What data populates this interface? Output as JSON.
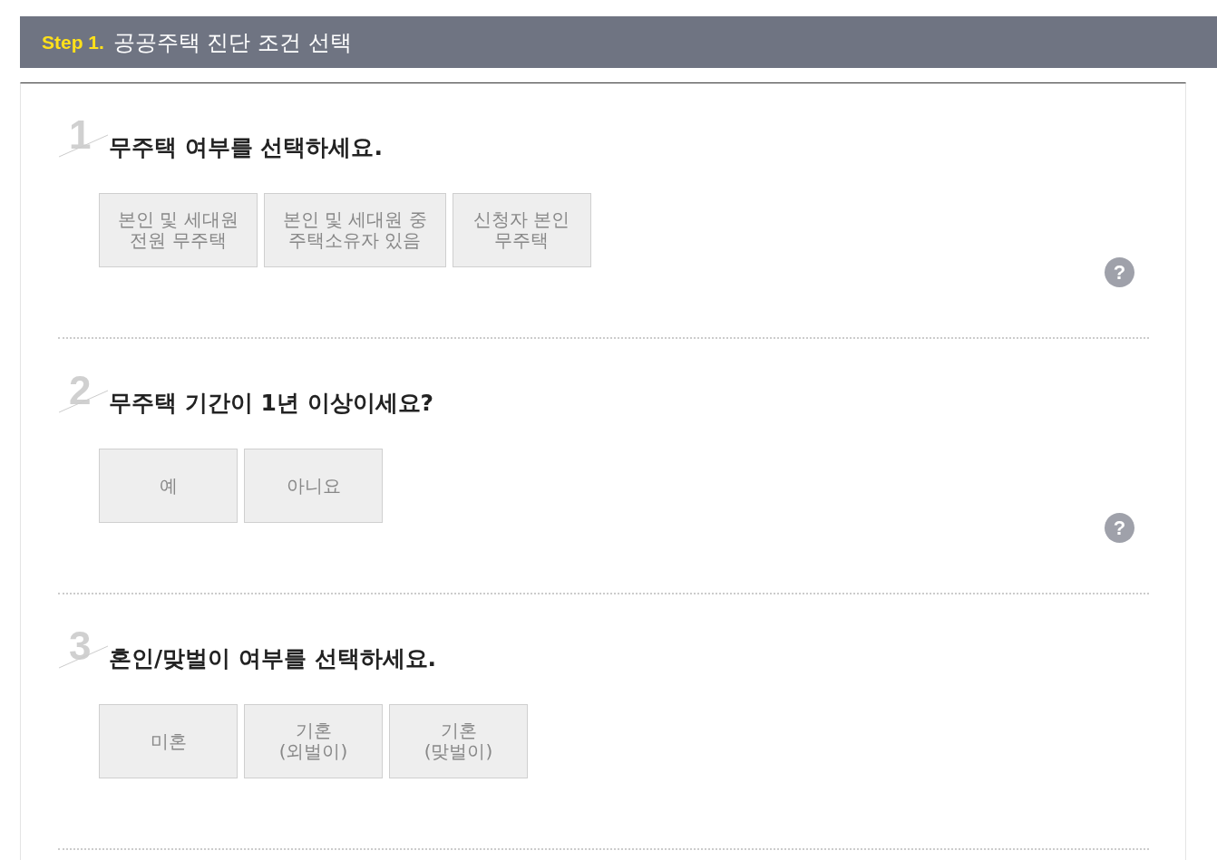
{
  "header": {
    "step": "Step 1.",
    "title": "공공주택 진단 조건 선택"
  },
  "questions": [
    {
      "number": "1",
      "title": "무주택 여부를 선택하세요.",
      "options": [
        {
          "label": "본인 및 세대원\n전원 무주택",
          "selected": false
        },
        {
          "label": "본인 및 세대원 중\n주택소유자 있음",
          "selected": false
        },
        {
          "label": "신청자 본인\n무주택",
          "selected": false
        }
      ],
      "help": "?"
    },
    {
      "number": "2",
      "title": "무주택 기간이 1년 이상이세요?",
      "options": [
        {
          "label": "예",
          "selected": false
        },
        {
          "label": "아니요",
          "selected": false
        }
      ],
      "help": "?"
    },
    {
      "number": "3",
      "title": "혼인/맞벌이 여부를 선택하세요.",
      "options": [
        {
          "label": "미혼",
          "selected": false
        },
        {
          "label": "기혼\n(외벌이)",
          "selected": false
        },
        {
          "label": "기혼\n(맞벌이)",
          "selected": false
        }
      ]
    }
  ]
}
